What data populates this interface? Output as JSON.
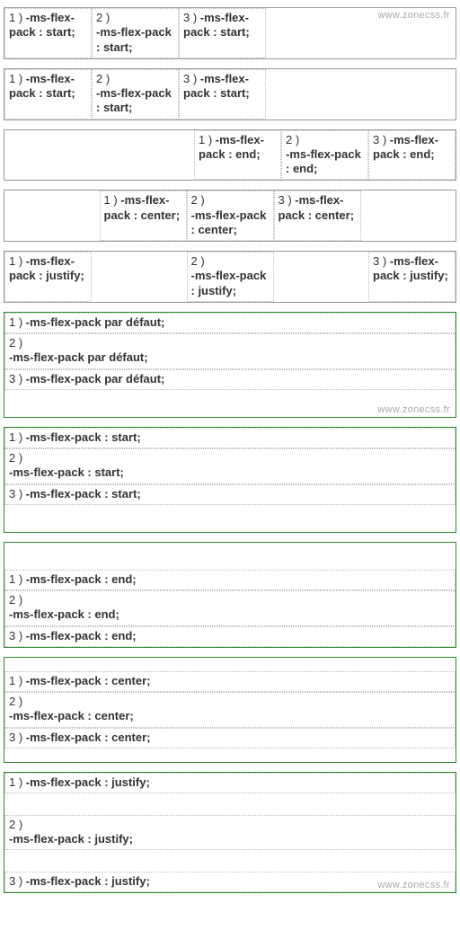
{
  "watermark": "www.zonecss.fr",
  "hrow": {
    "default": {
      "c1": "1 ) <b>-ms-flex-pack : start;</b>",
      "c2": "2 )<br><b>-ms-flex-pack : start;</b>",
      "c3": "3 ) <b>-ms-flex-pack : start;</b>"
    },
    "start": {
      "c1": "1 ) <b>-ms-flex-pack : start;</b>",
      "c2": "2 )<br><b>-ms-flex-pack : start;</b>",
      "c3": "3 ) <b>-ms-flex-pack : start;</b>"
    },
    "end": {
      "c1": "1 ) <b>-ms-flex-pack : end;</b>",
      "c2": "2 )<br><b>-ms-flex-pack : end;</b>",
      "c3": "3 ) <b>-ms-flex-pack : end;</b>"
    },
    "center": {
      "c1": "1 ) <b>-ms-flex-pack : center;</b>",
      "c2": "2 )<br><b>-ms-flex-pack : center;</b>",
      "c3": "3 ) <b>-ms-flex-pack : center;</b>"
    },
    "justify": {
      "c1": "1 ) <b>-ms-flex-pack : justify;</b>",
      "c2": "2 )<br><b>-ms-flex-pack : justify;</b>",
      "c3": "3 ) <b>-ms-flex-pack : justify;</b>"
    }
  },
  "vcol": {
    "default": {
      "r1": "1 ) <b>-ms-flex-pack par défaut;</b>",
      "r2": "2 )<br><b>-ms-flex-pack par défaut;</b>",
      "r3": "3 ) <b>-ms-flex-pack par défaut;</b>"
    },
    "start": {
      "r1": "1 ) <b>-ms-flex-pack : start;</b>",
      "r2": "2 )<br><b>-ms-flex-pack : start;</b>",
      "r3": "3 ) <b>-ms-flex-pack : start;</b>"
    },
    "end": {
      "r1": "1 ) <b>-ms-flex-pack : end;</b>",
      "r2": "2 )<br><b>-ms-flex-pack : end;</b>",
      "r3": "3 ) <b>-ms-flex-pack : end;</b>"
    },
    "center": {
      "r1": "1 ) <b>-ms-flex-pack : center;</b>",
      "r2": "2 )<br><b>-ms-flex-pack : center;</b>",
      "r3": "3 ) <b>-ms-flex-pack : center;</b>"
    },
    "justify": {
      "r1": "1 ) <b>-ms-flex-pack : justify;</b>",
      "r2": "2 )<br><b>-ms-flex-pack : justify;</b>",
      "r3": "3 ) <b>-ms-flex-pack : justify;</b>"
    }
  }
}
